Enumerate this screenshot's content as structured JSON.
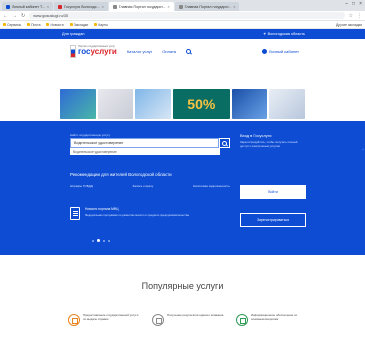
{
  "browser": {
    "tabs": [
      {
        "label": "Личный кабинет Т...",
        "active": false
      },
      {
        "label": "Госуслуги Вологодс...",
        "active": false
      },
      {
        "label": "Главная Портал государст...",
        "active": true
      },
      {
        "label": "Главная Портал государст...",
        "active": false
      }
    ],
    "url": "www.gosuslugi.ru/35",
    "bookmarks": [
      "Сервисы",
      "Почта",
      "Новости",
      "Закладки",
      "Карты"
    ],
    "bookmarks_right": "Другие закладки"
  },
  "site": {
    "top_strip": {
      "left": "Для граждан",
      "region": "Вологодская область"
    },
    "logo": {
      "sub": "Портал государственных услуг",
      "main_blue": "гос",
      "main_red": "услуги"
    },
    "nav": [
      "Каталог услуг",
      "Оплата"
    ],
    "login": "Личный кабинет",
    "banner_sale": "50%"
  },
  "hero": {
    "search_hint": "Найти государственную услугу",
    "search_value": "Водительское удостоверение",
    "suggest": "Водительское удостоверение",
    "rec_title": "Рекомендации для жителей Вологодской области",
    "rec_links": [
      "Штрафы ГИБДД",
      "Запись к врачу",
      "Налоговая задолженность"
    ],
    "news_title": "Новости портала МФЦ",
    "news_desc": "Федеральная программа по развитию малого и среднего предпринимательства",
    "side_title": "Вход в Госуслуги",
    "side_desc": "Зарегистрируйтесь, чтобы получить полный доступ к электронным услугам",
    "btn_login": "Войти",
    "btn_register": "Зарегистрироваться",
    "feedback": "‹"
  },
  "popular": {
    "title": "Популярные услуги",
    "services": [
      {
        "label": "Предоставление государственной услуги по выдаче справок",
        "icon": "document-icon",
        "color": "#e8841f"
      },
      {
        "label": "Получение результатов единого экзамена",
        "icon": "building-icon",
        "color": "#8a8a8a"
      },
      {
        "label": "Информационное обеспечение по основным вопросам",
        "icon": "shield-icon",
        "color": "#2e9b57"
      }
    ]
  }
}
